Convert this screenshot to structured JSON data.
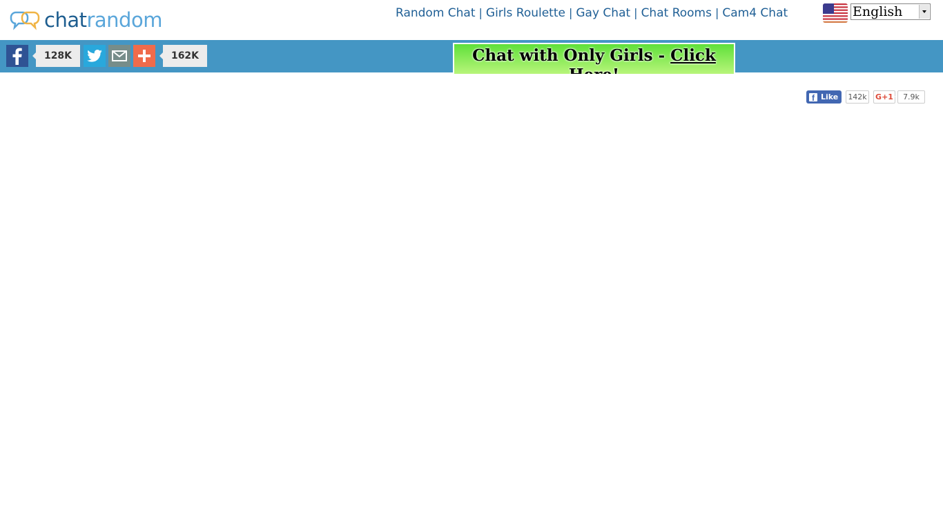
{
  "logo": {
    "part1": "chat",
    "part2": "random"
  },
  "nav": {
    "items": [
      {
        "label": "Random Chat"
      },
      {
        "label": "Girls Roulette"
      },
      {
        "label": "Gay Chat"
      },
      {
        "label": "Chat Rooms"
      },
      {
        "label": "Cam4 Chat"
      }
    ],
    "separator": "|"
  },
  "language": {
    "selected": "English",
    "flag_icon": "us-flag-icon"
  },
  "share": {
    "facebook_count": "128K",
    "total_count": "162K"
  },
  "promo": {
    "text": "Chat with Only Girls - ",
    "link_text": "Click Here!"
  },
  "social": {
    "fb_like_label": "Like",
    "fb_like_count": "142k",
    "gplus_label": "G+1",
    "gplus_count": "7.9k"
  },
  "colors": {
    "sharebar": "#4496c4",
    "nav_link": "#1f5f95",
    "facebook": "#2f5394",
    "twitter": "#29a8dc",
    "email": "#778d8a",
    "addthis": "#f06b4b"
  }
}
